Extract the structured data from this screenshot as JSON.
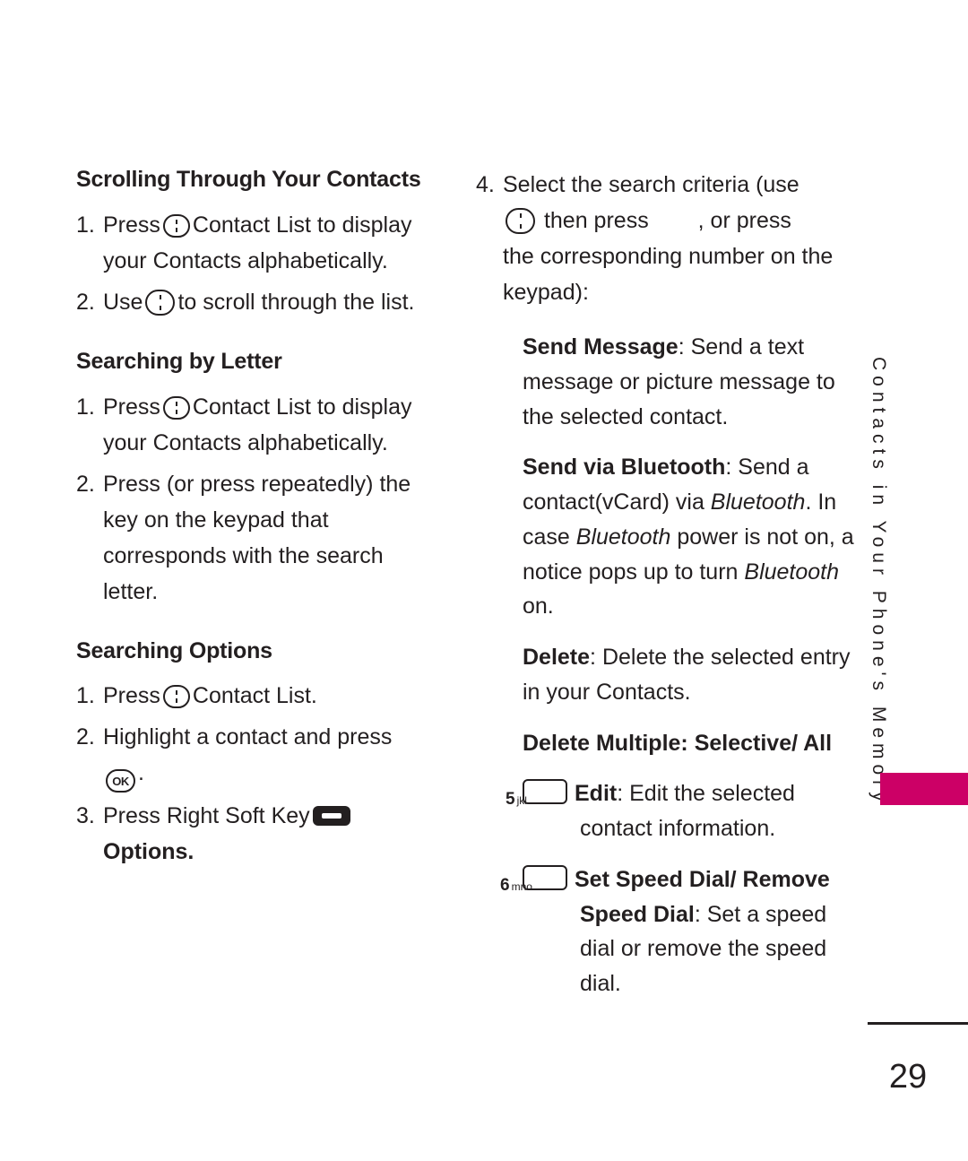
{
  "page": {
    "number": "29",
    "side_tab_text": "Contacts in Your Phone's Memory",
    "accent_color": "#cc0066",
    "text_color": "#231f20"
  },
  "left_column": {
    "section1": {
      "heading": "Scrolling Through Your Contacts",
      "steps": [
        {
          "num": "1.",
          "before_icon": "Press",
          "icon": "nav-key-icon",
          "after_icon": "Contact List to display your Contacts alphabetically."
        },
        {
          "num": "2.",
          "before_icon": "Use",
          "icon": "nav-key-icon",
          "after_icon": "to scroll through the list."
        }
      ]
    },
    "section2": {
      "heading": "Searching by Letter",
      "steps": [
        {
          "num": "1.",
          "before_icon": "Press",
          "icon": "nav-key-icon",
          "after_icon": "Contact List to display your Contacts alphabetically."
        },
        {
          "num": "2.",
          "before_icon": "",
          "icon": "",
          "after_icon": "Press (or press repeatedly) the key on the keypad that corresponds with the search letter."
        }
      ]
    },
    "section3": {
      "heading": "Searching Options",
      "steps": [
        {
          "num": "1.",
          "before_icon": "Press",
          "icon": "nav-key-icon",
          "after_icon": "Contact List."
        },
        {
          "num": "2.",
          "before_icon": "",
          "icon": "ok-key-icon",
          "after_icon": "Highlight a contact and press",
          "trailing": "."
        },
        {
          "num": "3.",
          "before_icon": "Press Right Soft Key",
          "icon": "soft-key-icon",
          "after_icon": "Options.",
          "bold_tail": "Options."
        }
      ]
    }
  },
  "right_column": {
    "step4": {
      "num": "4.",
      "line1": "Select the search criteria (use",
      "line2_before": "then press",
      "line2_after": ", or press",
      "line3": "the corresponding number on the keypad):"
    },
    "options": [
      {
        "key_digit": "",
        "key_letters": "",
        "title": "Send Message",
        "body": ": Send a text message or picture message to the selected contact."
      },
      {
        "key_digit": "",
        "key_letters": "",
        "title": "Send via Bluetooth",
        "body": ": Send a contact(vCard) via Bluetooth. In case Bluetooth power is not on, a notice pops up to turn Bluetooth on."
      },
      {
        "key_digit": "",
        "key_letters": "",
        "title": "Delete",
        "body": ": Delete the selected entry in your Contacts."
      },
      {
        "key_digit": "",
        "key_letters": "",
        "title": "Delete Multiple",
        "body": ": Selective/ All"
      },
      {
        "key_digit": "5",
        "key_letters": "jkl",
        "title": "Edit",
        "body": ": Edit the selected contact information."
      },
      {
        "key_digit": "6",
        "key_letters": "mno",
        "title": "Set Speed Dial/ Remove Speed Dial",
        "body": ": Set a speed dial or remove the speed dial."
      }
    ],
    "ok_label": "OK"
  }
}
